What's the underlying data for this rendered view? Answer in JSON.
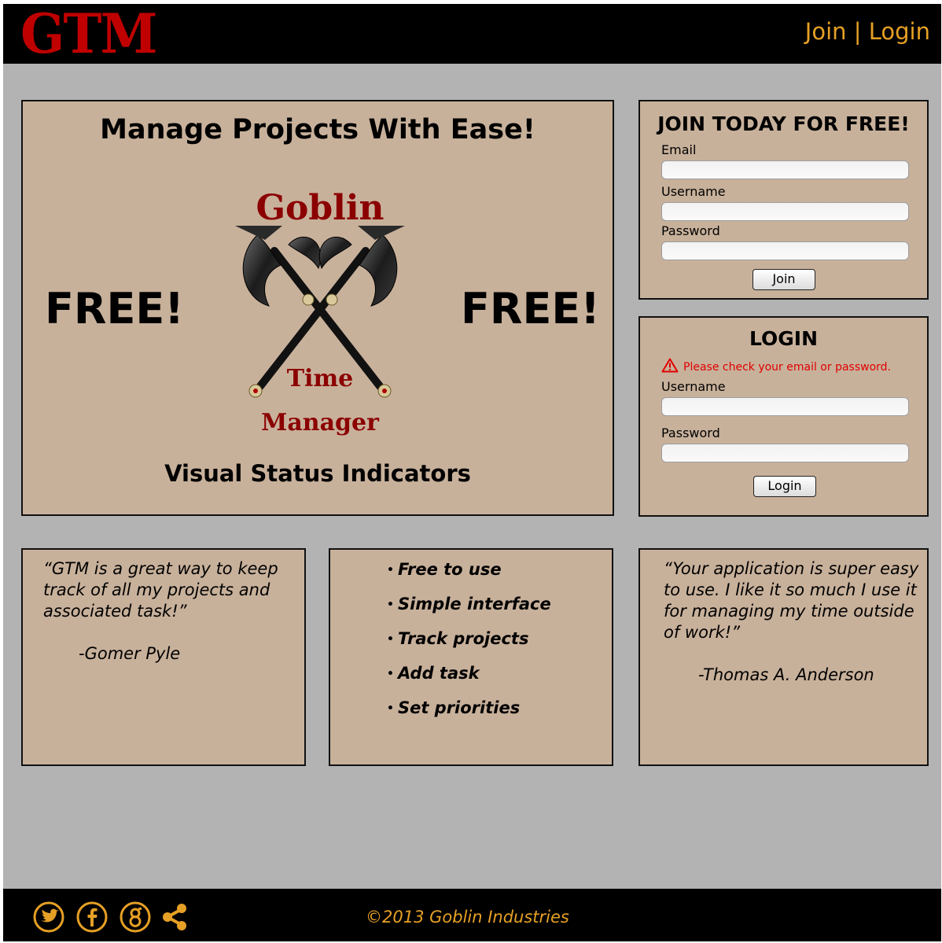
{
  "header": {
    "brand": "GTM",
    "nav_join": "Join",
    "nav_separator": "|",
    "nav_login": "Login"
  },
  "hero": {
    "title": "Manage Projects With Ease!",
    "free_left": "FREE!",
    "free_right": "FREE!",
    "logo_word_1": "Goblin",
    "logo_word_2": "Time",
    "logo_word_3": "Manager",
    "subtitle": "Visual Status Indicators"
  },
  "join_form": {
    "title": "JOIN TODAY FOR FREE!",
    "email_label": "Email",
    "email_value": "",
    "username_label": "Username",
    "username_value": "",
    "password_label": "Password",
    "password_value": "",
    "button": "Join"
  },
  "login_form": {
    "title": "LOGIN",
    "error": "Please check your email or password.",
    "username_label": "Username",
    "username_value": "",
    "password_label": "Password",
    "password_value": "",
    "button": "Login"
  },
  "testimonial_1": {
    "quote": "“GTM is a great way to keep track of all my projects and associated task!”",
    "author": "-Gomer Pyle"
  },
  "features": {
    "bullet": "•",
    "items": [
      "Free to use",
      "Simple interface",
      "Track projects",
      "Add task",
      "Set priorities"
    ]
  },
  "testimonial_2": {
    "quote": "“Your application is super easy to use. I like it so much I use it for managing my time outside of work!”",
    "author": "-Thomas A. Anderson"
  },
  "footer": {
    "copyright": "©2013 Goblin Industries",
    "icons": [
      "twitter-icon",
      "facebook-icon",
      "google-plus-icon",
      "share-icon"
    ]
  },
  "colors": {
    "accent": "#e6a025",
    "brand_red": "#c00000",
    "panel": "#c8b19b",
    "background": "#b3b3b3",
    "bar": "#000000",
    "error": "#e00000"
  }
}
